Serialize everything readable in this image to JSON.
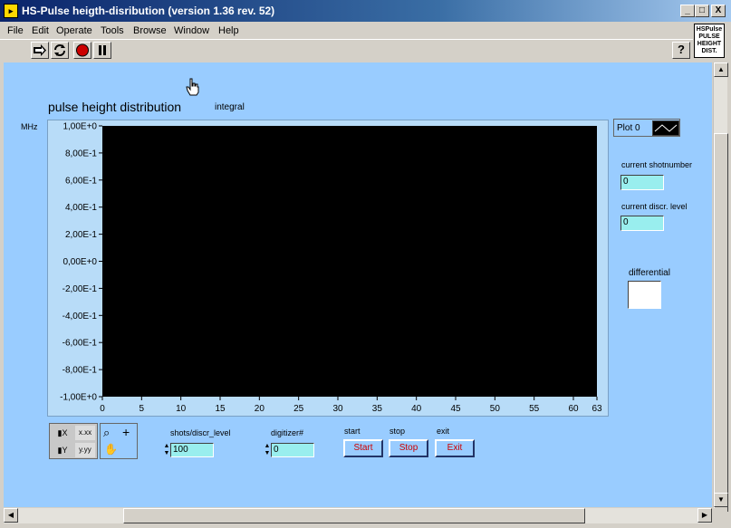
{
  "window": {
    "title": "HS-Pulse heigth-disribution (version 1.36 rev. 52)",
    "icon": "labview-vi-icon",
    "controls": [
      "_",
      "□",
      "X"
    ]
  },
  "menu": {
    "items": [
      {
        "label": "File"
      },
      {
        "label": "Edit"
      },
      {
        "label": "Operate"
      },
      {
        "label": "Tools"
      },
      {
        "label": "Browse"
      },
      {
        "label": "Window"
      },
      {
        "label": "Help"
      }
    ]
  },
  "toolbar": {
    "buttons": [
      "run-arrow-icon",
      "run-continuously-icon",
      "abort-stop-icon",
      "pause-icon"
    ],
    "help": "?"
  },
  "logo": {
    "lines": [
      "HSPulse",
      "PULSE",
      "HEIGHT",
      "DIST."
    ]
  },
  "graph": {
    "title": "pulse height distribution",
    "mode_label": "integral",
    "y_unit": "MHz",
    "legend_label": "Plot 0"
  },
  "chart_data": {
    "type": "line",
    "title": "pulse height distribution",
    "xlabel": "",
    "ylabel": "MHz",
    "xlim": [
      0,
      63
    ],
    "ylim": [
      -1.0,
      1.0
    ],
    "x_ticks": [
      "0",
      "5",
      "10",
      "15",
      "20",
      "25",
      "30",
      "35",
      "40",
      "45",
      "50",
      "55",
      "60",
      "63"
    ],
    "y_ticks": [
      "1,00E+0",
      "8,00E-1",
      "6,00E-1",
      "4,00E-1",
      "2,00E-1",
      "0,00E+0",
      "-2,00E-1",
      "-4,00E-1",
      "-6,00E-1",
      "-8,00E-1",
      "-1,00E+0"
    ],
    "series": [],
    "plot_background": "#000000"
  },
  "indicators": {
    "shotnumber_label": "current shotnumber",
    "shotnumber_value": "0",
    "discr_label": "current discr. level",
    "discr_value": "0",
    "differential_label": "differential"
  },
  "controls": {
    "shots_label": "shots/discr_level",
    "shots_value": "100",
    "digitizer_label": "digitizer#",
    "digitizer_value": "0",
    "start_label": "start",
    "start_button": "Start",
    "stop_label": "stop",
    "stop_button": "Stop",
    "exit_label": "exit",
    "exit_button": "Exit"
  },
  "colors": {
    "panel": "#99ccff",
    "plot": "#000000",
    "button_text": "#cc0000",
    "numeric_field": "#99eeee"
  }
}
